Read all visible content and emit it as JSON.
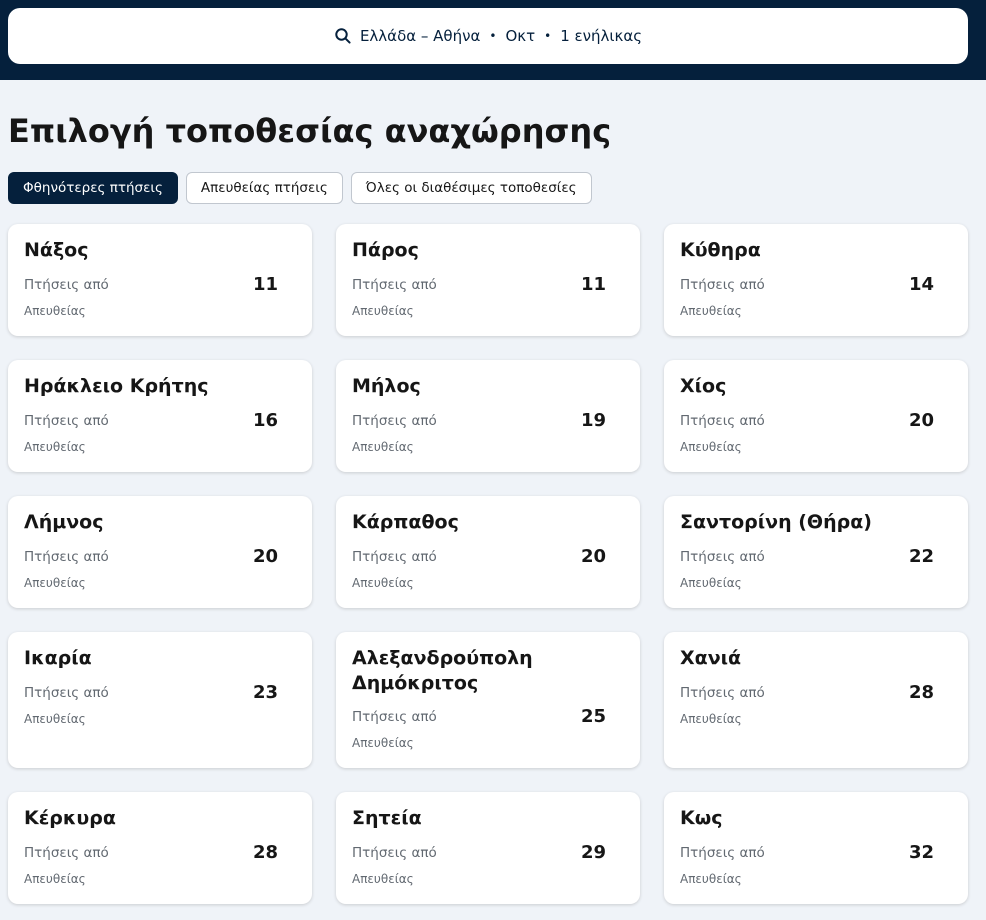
{
  "search": {
    "destination": "Ελλάδα – Αθήνα",
    "month": "Οκτ",
    "travellers": "1 ενήλικας"
  },
  "page": {
    "title": "Επιλογή τοποθεσίας αναχώρησης"
  },
  "tabs": [
    {
      "label": "Φθηνότερες πτήσεις",
      "active": true
    },
    {
      "label": "Απευθείας πτήσεις",
      "active": false
    },
    {
      "label": "Όλες οι διαθέσιμες τοποθεσίες",
      "active": false
    }
  ],
  "cards": [
    {
      "city": "Νάξος",
      "from_label": "Πτήσεις από",
      "price": "11",
      "direct": "Απευθείας"
    },
    {
      "city": "Πάρος",
      "from_label": "Πτήσεις από",
      "price": "11",
      "direct": "Απευθείας"
    },
    {
      "city": "Κύθηρα",
      "from_label": "Πτήσεις από",
      "price": "14",
      "direct": "Απευθείας"
    },
    {
      "city": "Ηράκλειο Κρήτης",
      "from_label": "Πτήσεις από",
      "price": "16",
      "direct": "Απευθείας"
    },
    {
      "city": "Μήλος",
      "from_label": "Πτήσεις από",
      "price": "19",
      "direct": "Απευθείας"
    },
    {
      "city": "Χίος",
      "from_label": "Πτήσεις από",
      "price": "20",
      "direct": "Απευθείας"
    },
    {
      "city": "Λήμνος",
      "from_label": "Πτήσεις από",
      "price": "20",
      "direct": "Απευθείας"
    },
    {
      "city": "Κάρπαθος",
      "from_label": "Πτήσεις από",
      "price": "20",
      "direct": "Απευθείας"
    },
    {
      "city": "Σαντορίνη (Θήρα)",
      "from_label": "Πτήσεις από",
      "price": "22",
      "direct": "Απευθείας"
    },
    {
      "city": "Ικαρία",
      "from_label": "Πτήσεις από",
      "price": "23",
      "direct": "Απευθείας"
    },
    {
      "city": "Αλεξανδρούπολη Δημόκριτος",
      "from_label": "Πτήσεις από",
      "price": "25",
      "direct": "Απευθείας"
    },
    {
      "city": "Χανιά",
      "from_label": "Πτήσεις από",
      "price": "28",
      "direct": "Απευθείας"
    },
    {
      "city": "Κέρκυρα",
      "from_label": "Πτήσεις από",
      "price": "28",
      "direct": "Απευθείας"
    },
    {
      "city": "Σητεία",
      "from_label": "Πτήσεις από",
      "price": "29",
      "direct": "Απευθείας"
    },
    {
      "city": "Κως",
      "from_label": "Πτήσεις από",
      "price": "32",
      "direct": "Απευθείας"
    }
  ]
}
